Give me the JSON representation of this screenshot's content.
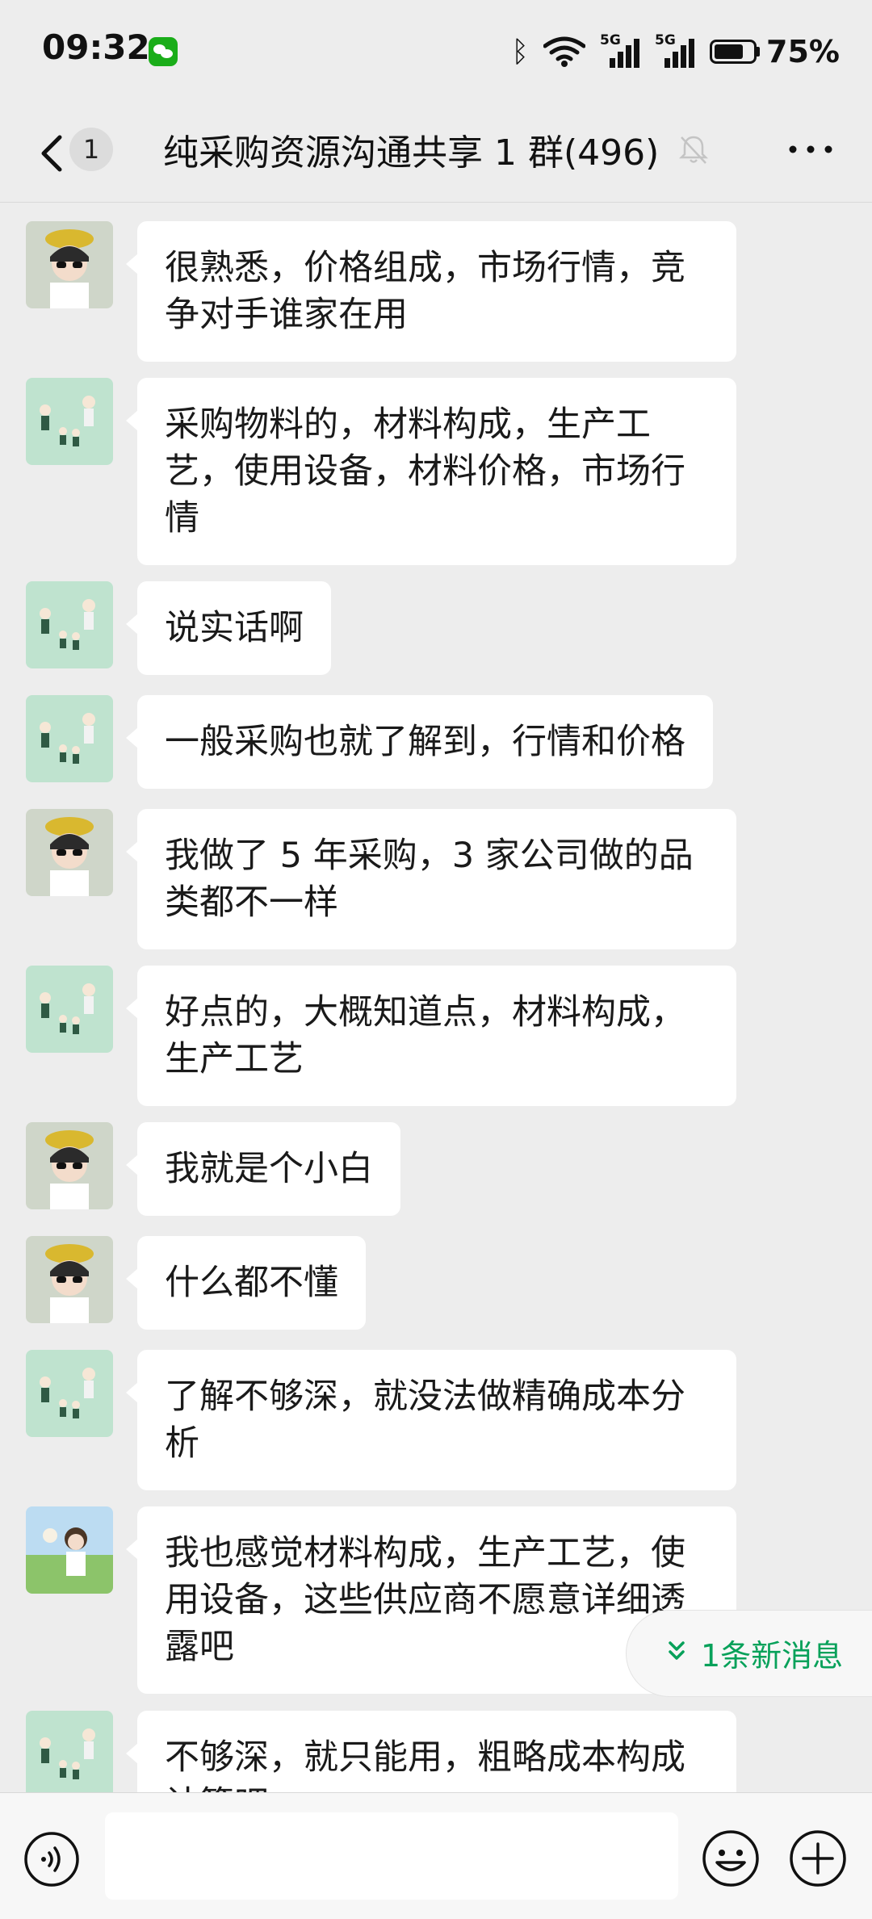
{
  "status_bar": {
    "time": "09:32",
    "network_1": "5G",
    "network_2": "5G",
    "battery_percent": "75%",
    "battery_level": 0.75
  },
  "header": {
    "unread_count": "1",
    "title": "纯采购资源沟通共享 1 群(496)"
  },
  "messages": [
    {
      "avatar": "avatar-girl-sunglasses",
      "text": "很熟悉，价格组成，市场行情，竞争对手谁家在用"
    },
    {
      "avatar": "avatar-family-green",
      "text": "采购物料的，材料构成，生产工艺，使用设备，材料价格，市场行情"
    },
    {
      "avatar": "avatar-family-green",
      "text": "说实话啊"
    },
    {
      "avatar": "avatar-family-green",
      "text": "一般采购也就了解到，行情和价格"
    },
    {
      "avatar": "avatar-girl-sunglasses",
      "text": "我做了 5 年采购，3 家公司做的品类都不一样"
    },
    {
      "avatar": "avatar-family-green",
      "text": "好点的，大概知道点，材料构成，生产工艺"
    },
    {
      "avatar": "avatar-girl-sunglasses",
      "text": "我就是个小白"
    },
    {
      "avatar": "avatar-girl-sunglasses",
      "text": "什么都不懂"
    },
    {
      "avatar": "avatar-family-green",
      "text": "了解不够深，就没法做精确成本分析"
    },
    {
      "avatar": "avatar-girl-field",
      "text": "我也感觉材料构成，生产工艺，使用设备，这些供应商不愿意详细透露吧"
    },
    {
      "avatar": "avatar-family-green",
      "text": "不够深，就只能用，粗略成本构成计算吧"
    }
  ],
  "new_message_pill": {
    "label": "1条新消息"
  },
  "input": {
    "value": "",
    "placeholder": ""
  },
  "colors": {
    "background": "#ededed",
    "bubble": "#ffffff",
    "accent_green": "#07a15a"
  }
}
